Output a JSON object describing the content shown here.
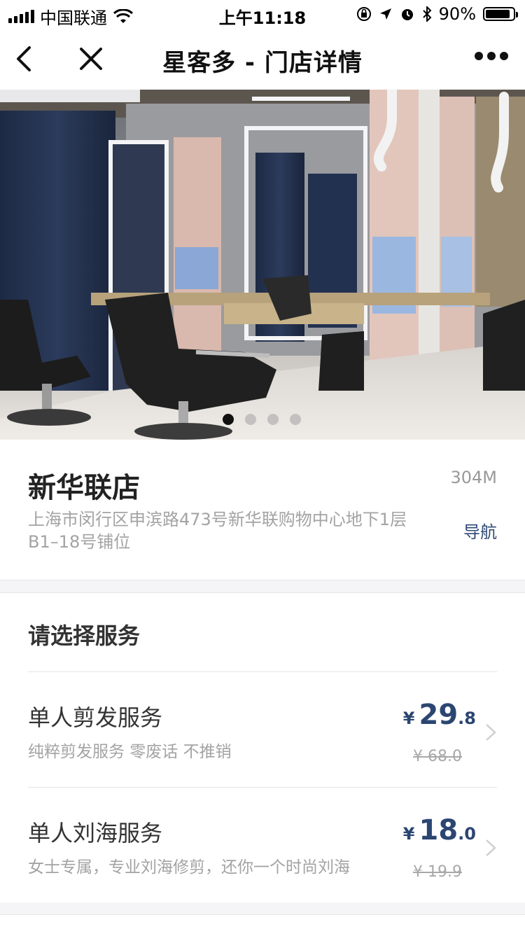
{
  "status_bar": {
    "carrier": "中国联通",
    "time": "上午11:18",
    "battery_text": "90%",
    "battery_level": 0.9
  },
  "nav": {
    "title": "星客多 - 门店详情",
    "back_icon": "chevron-left-icon",
    "close_icon": "close-icon",
    "more_icon": "more-dots-icon"
  },
  "hero": {
    "image": "salon-interior-photo",
    "carousel_count": 4,
    "carousel_active": 1
  },
  "store": {
    "name": "新华联店",
    "distance": "304M",
    "address_line1": "上海市闵行区申滨路473号新华联购物中心地下1层",
    "address_line2": "B1–18号铺位",
    "nav_label": "导航"
  },
  "services": {
    "title": "请选择服务",
    "items": [
      {
        "name": "单人剪发服务",
        "desc": "纯粹剪发服务 零废话 不推销",
        "currency": "¥",
        "price_int": "29",
        "price_dec": ".8",
        "original": "¥ 68.0"
      },
      {
        "name": "单人刘海服务",
        "desc": "女士专属，专业刘海修剪，还你一个时尚刘海",
        "currency": "¥",
        "price_int": "18",
        "price_dec": ".0",
        "original": "¥ 19.9"
      }
    ]
  },
  "colors": {
    "accent": "#2c4672",
    "muted_text": "#a3a3a3",
    "background": "#f5f5f7"
  }
}
